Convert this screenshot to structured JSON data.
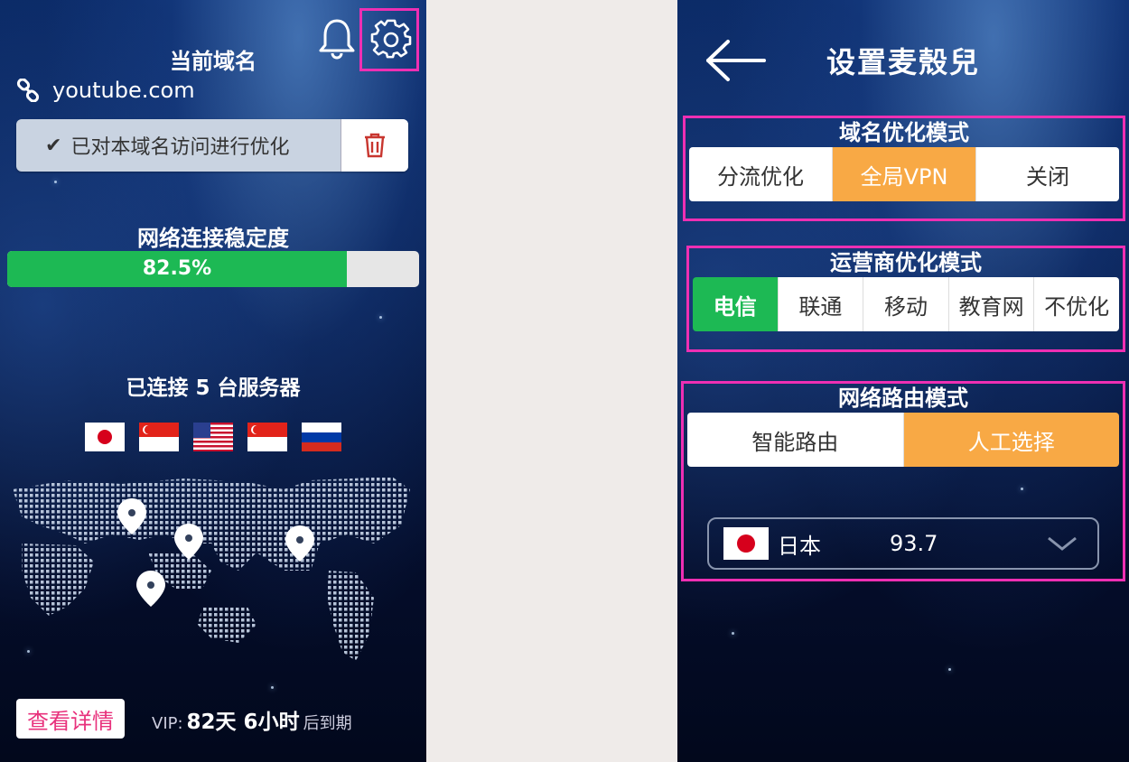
{
  "left": {
    "current_domain_title": "当前域名",
    "domain": "youtube.com",
    "optimized_text": "已对本域名访问进行优化",
    "stability_title": "网络连接稳定度",
    "stability_value": "82.5%",
    "stability_fraction": 0.825,
    "servers": {
      "prefix": "已连接",
      "count": "5",
      "suffix": "台服务器"
    },
    "flags": [
      "japan",
      "singapore",
      "usa",
      "singapore",
      "russia"
    ],
    "detail_button": "查看详情",
    "vip": {
      "label": "VIP:",
      "value": "82天 6小时",
      "suffix": "后到期"
    }
  },
  "right": {
    "title": "设置麦殼兒",
    "domain_mode": {
      "title": "域名优化模式",
      "options": [
        "分流优化",
        "全局VPN",
        "关闭"
      ],
      "selected": 1
    },
    "carrier_mode": {
      "title": "运营商优化模式",
      "options": [
        "电信",
        "联通",
        "移动",
        "教育网",
        "不优化"
      ],
      "selected": 0
    },
    "route_mode": {
      "title": "网络路由模式",
      "options": [
        "智能路由",
        "人工选择"
      ],
      "selected": 1,
      "server_select": {
        "flag": "japan",
        "country": "日本",
        "score": "93.7"
      }
    }
  },
  "colors": {
    "accent_orange": "#f8a945",
    "accent_green": "#1db954",
    "highlight_pink": "#ee2fb3",
    "detail_pink": "#e8317c"
  },
  "icons": [
    "bell-icon",
    "gear-icon",
    "link-icon",
    "check-icon",
    "trash-icon",
    "back-arrow-icon",
    "chevron-down-icon",
    "map-pin-icon"
  ]
}
